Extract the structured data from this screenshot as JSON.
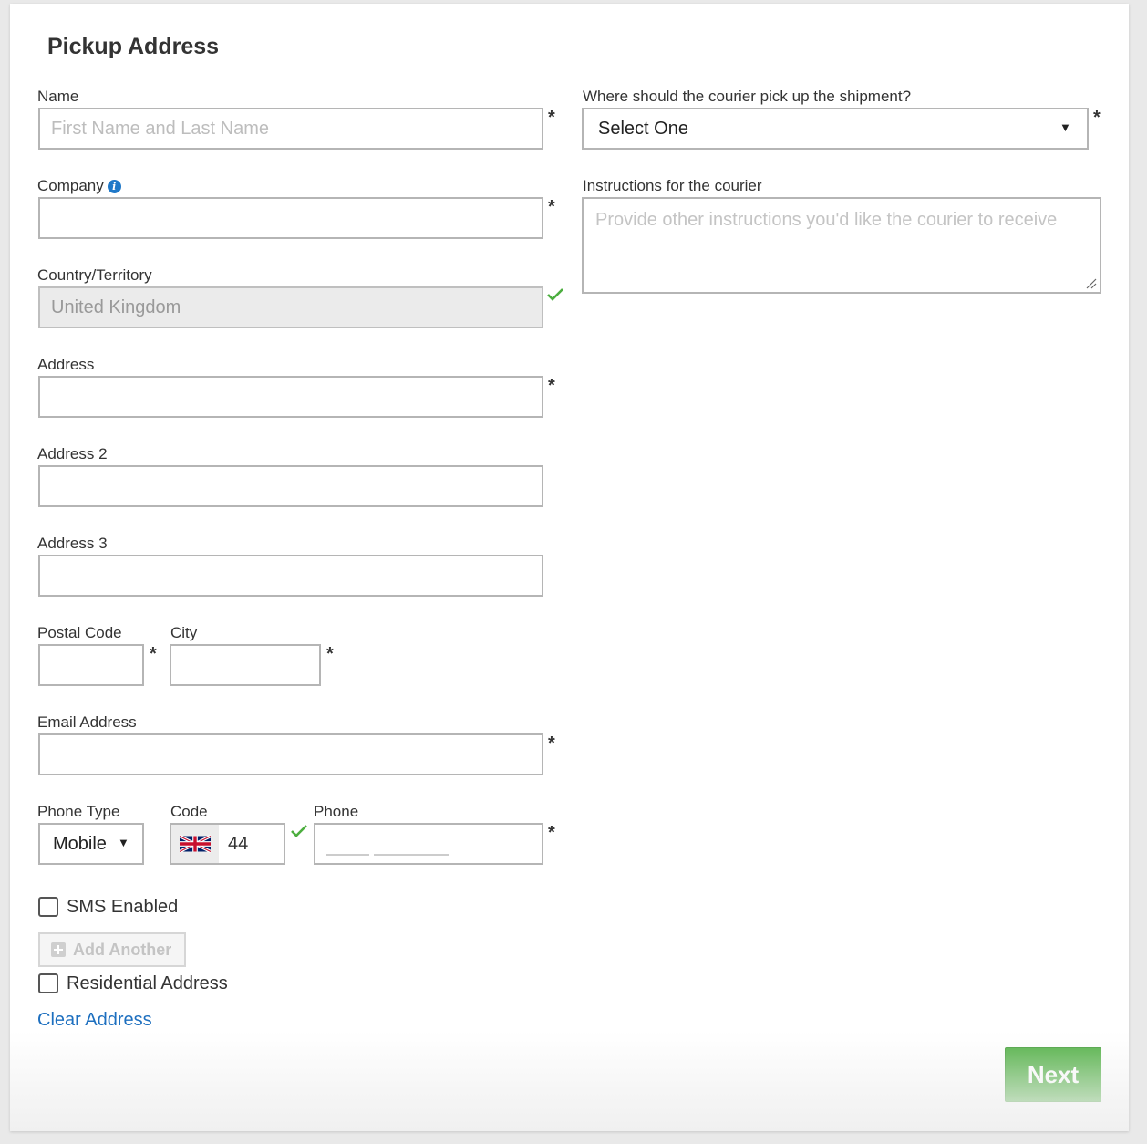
{
  "form": {
    "title": "Pickup Address",
    "name": {
      "label": "Name",
      "placeholder": "First Name and Last Name",
      "required_mark": "*"
    },
    "company": {
      "label": "Company",
      "info_icon": "i",
      "required_mark": "*"
    },
    "country": {
      "label": "Country/Territory",
      "value": "United Kingdom"
    },
    "address": {
      "label": "Address",
      "required_mark": "*"
    },
    "address2": {
      "label": "Address 2"
    },
    "address3": {
      "label": "Address 3"
    },
    "postal": {
      "label": "Postal Code",
      "required_mark": "*"
    },
    "city": {
      "label": "City",
      "required_mark": "*"
    },
    "email": {
      "label": "Email Address",
      "required_mark": "*"
    },
    "phone_type": {
      "label": "Phone Type",
      "value": "Mobile"
    },
    "code": {
      "label": "Code",
      "value": "44",
      "flag_icon": "uk-flag-icon"
    },
    "phone": {
      "label": "Phone",
      "required_mark": "*"
    },
    "sms": {
      "label": "SMS Enabled"
    },
    "add_another": {
      "label": "Add Another"
    },
    "residential": {
      "label": "Residential Address"
    },
    "clear": {
      "label": "Clear Address"
    }
  },
  "pickup": {
    "location": {
      "label": "Where should the courier pick up the shipment?",
      "value": "Select One",
      "required_mark": "*"
    },
    "instructions": {
      "label": "Instructions for the courier",
      "placeholder": "Provide other instructions you'd like the courier to receive"
    }
  },
  "actions": {
    "next": "Next"
  },
  "colors": {
    "accent": "#4cae3f",
    "link": "#1d6fbf",
    "valid": "#4cae3f",
    "info": "#1f78c8"
  }
}
